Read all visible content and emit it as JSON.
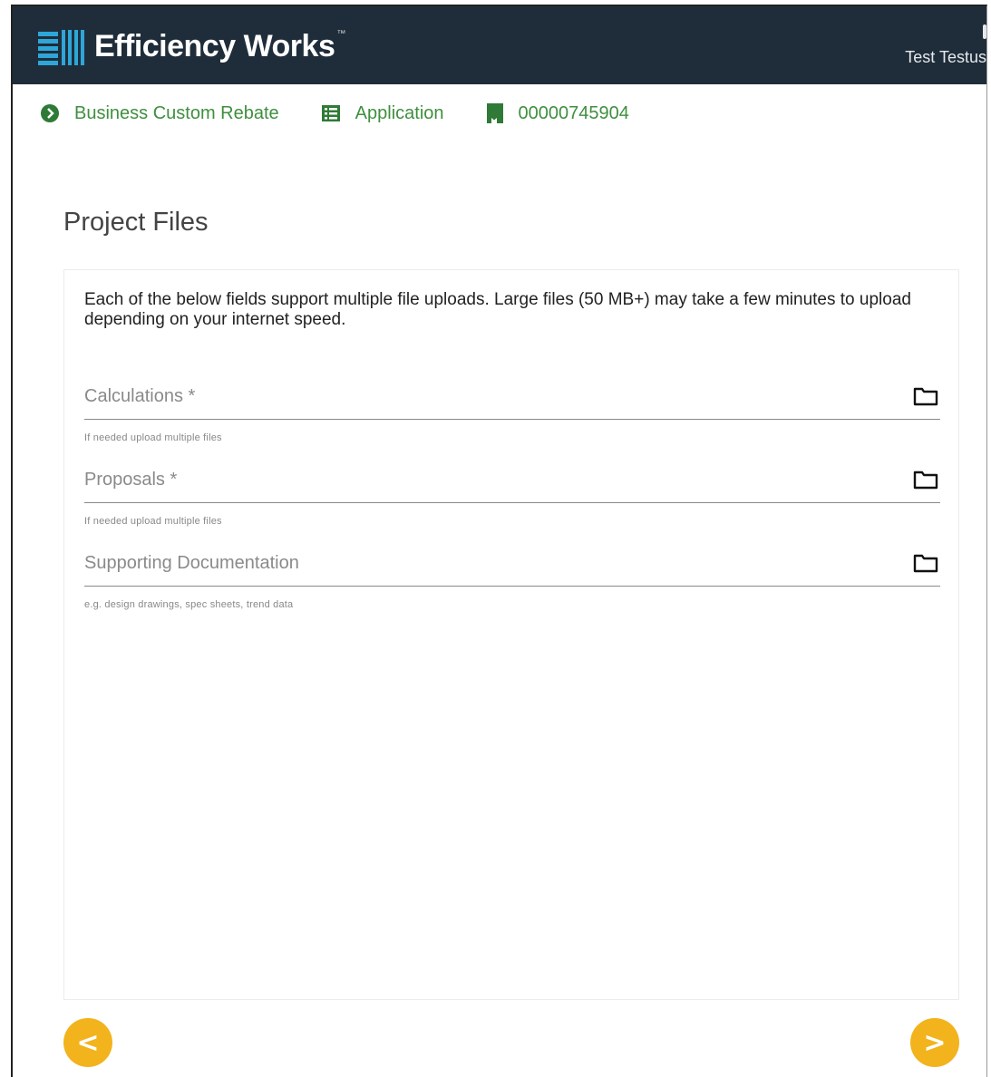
{
  "header": {
    "brand": "Efficiency Works",
    "brand_tm": "™",
    "user_name": "Test Testus"
  },
  "breadcrumbs": [
    {
      "label": "Business Custom Rebate",
      "icon": "chevron-circle-icon"
    },
    {
      "label": "Application",
      "icon": "list-icon"
    },
    {
      "label": "00000745904",
      "icon": "bookmark-icon"
    }
  ],
  "page": {
    "title": "Project Files",
    "intro": "Each of the below fields support multiple file uploads. Large files (50 MB+) may take a few minutes to upload depending on your internet speed."
  },
  "fields": [
    {
      "label": "Calculations *",
      "hint": "If needed upload multiple files"
    },
    {
      "label": "Proposals *",
      "hint": "If needed upload multiple files"
    },
    {
      "label": "Supporting Documentation",
      "hint": "e.g. design drawings, spec sheets, trend data"
    }
  ],
  "nav": {
    "prev_label": "<",
    "next_label": ">"
  },
  "colors": {
    "header_bg": "#1f2d3a",
    "brand_accent": "#2ea6d8",
    "breadcrumb_green": "#3f8f3f",
    "nav_button": "#f2b31c"
  }
}
